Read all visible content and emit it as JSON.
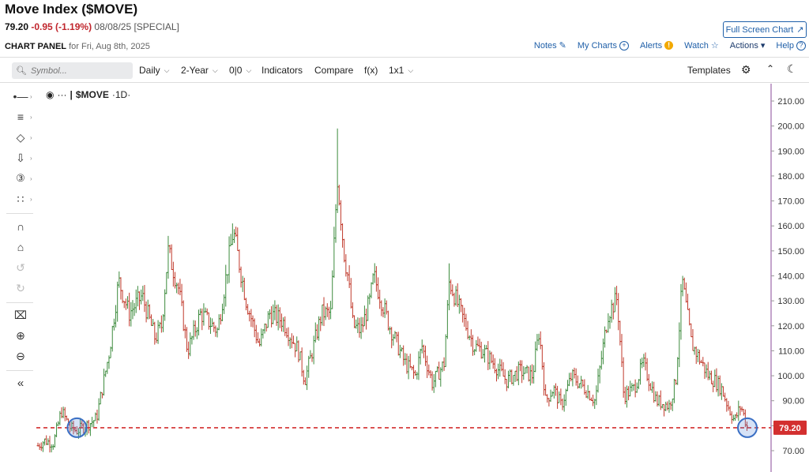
{
  "header": {
    "title": "Move Index ($MOVE)",
    "price": "79.20",
    "change": "-0.95 (-1.19%)",
    "date_meta": "08/08/25 [SPECIAL]",
    "full_screen_label": "Full Screen Chart"
  },
  "panel": {
    "label": "CHART PANEL",
    "for_text": "for Fri, Aug 8th, 2025"
  },
  "links": {
    "notes": "Notes",
    "my_charts": "My Charts",
    "alerts": "Alerts",
    "watch": "Watch",
    "actions": "Actions",
    "help": "Help"
  },
  "toolbar": {
    "search_placeholder": "Symbol...",
    "interval": "Daily",
    "range": "2-Year",
    "chart_style": "0|0",
    "indicators": "Indicators",
    "compare": "Compare",
    "fx": "f(x)",
    "layout": "1x1",
    "templates": "Templates"
  },
  "legend": {
    "symbol": "$MOVE",
    "interval": "1D"
  },
  "icons": {
    "sidebar": [
      "crosshair-icon",
      "fib-tools-icon",
      "shapes-icon",
      "arrow-icon",
      "counter-icon",
      "patterns-icon",
      "magnet-icon",
      "lock-icon",
      "undo-icon",
      "redo-icon",
      "trash-icon",
      "zoom-in-icon",
      "zoom-out-icon",
      "collapse-icon"
    ]
  },
  "chart_data": {
    "type": "ohlc",
    "symbol": "$MOVE",
    "interval": "1D",
    "range": "2-Year",
    "ylim": [
      63,
      215
    ],
    "y_ticks": [
      70,
      80,
      90,
      100,
      110,
      120,
      130,
      140,
      150,
      160,
      170,
      180,
      190,
      200,
      210
    ],
    "y_tick_labels": [
      "70.00",
      "80.00",
      "90.00",
      "100.00",
      "110.00",
      "120.00",
      "130.00",
      "140.00",
      "150.00",
      "160.00",
      "170.00",
      "180.00",
      "190.00",
      "200.00",
      "210.00"
    ],
    "last_price": 79.2,
    "last_price_label": "79.20",
    "x_range_days": [
      0,
      505
    ],
    "key_points": [
      [
        0,
        72
      ],
      [
        5,
        74
      ],
      [
        12,
        73
      ],
      [
        18,
        86
      ],
      [
        25,
        79
      ],
      [
        30,
        78
      ],
      [
        40,
        81
      ],
      [
        45,
        83
      ],
      [
        55,
        110
      ],
      [
        62,
        138
      ],
      [
        70,
        125
      ],
      [
        80,
        132
      ],
      [
        90,
        115
      ],
      [
        95,
        120
      ],
      [
        100,
        150
      ],
      [
        108,
        135
      ],
      [
        115,
        110
      ],
      [
        125,
        125
      ],
      [
        138,
        118
      ],
      [
        150,
        158
      ],
      [
        160,
        130
      ],
      [
        170,
        112
      ],
      [
        178,
        125
      ],
      [
        188,
        122
      ],
      [
        200,
        110
      ],
      [
        205,
        98
      ],
      [
        218,
        125
      ],
      [
        225,
        125
      ],
      [
        230,
        180
      ],
      [
        235,
        150
      ],
      [
        238,
        140
      ],
      [
        242,
        120
      ],
      [
        248,
        118
      ],
      [
        255,
        130
      ],
      [
        258,
        140
      ],
      [
        270,
        120
      ],
      [
        282,
        105
      ],
      [
        290,
        100
      ],
      [
        295,
        112
      ],
      [
        303,
        97
      ],
      [
        312,
        105
      ],
      [
        316,
        138
      ],
      [
        325,
        125
      ],
      [
        335,
        112
      ],
      [
        342,
        110
      ],
      [
        350,
        105
      ],
      [
        360,
        98
      ],
      [
        370,
        102
      ],
      [
        380,
        100
      ],
      [
        385,
        118
      ],
      [
        390,
        90
      ],
      [
        396,
        95
      ],
      [
        402,
        88
      ],
      [
        410,
        100
      ],
      [
        420,
        95
      ],
      [
        428,
        90
      ],
      [
        438,
        125
      ],
      [
        445,
        131
      ],
      [
        450,
        92
      ],
      [
        458,
        95
      ],
      [
        465,
        105
      ],
      [
        475,
        90
      ],
      [
        485,
        88
      ],
      [
        490,
        98
      ],
      [
        495,
        138
      ],
      [
        502,
        113
      ],
      [
        510,
        105
      ],
      [
        515,
        100
      ],
      [
        520,
        98
      ],
      [
        525,
        95
      ],
      [
        530,
        88
      ],
      [
        535,
        82
      ],
      [
        540,
        88
      ],
      [
        545,
        79.2
      ]
    ],
    "annotations": [
      {
        "type": "horizontal_line",
        "value": 79.2,
        "style": "dashed",
        "color": "#d32f2f"
      },
      {
        "type": "circle",
        "x": 30,
        "value": 79.2,
        "color": "#3a6fc4"
      },
      {
        "type": "circle",
        "x": 545,
        "value": 79.2,
        "color": "#3a6fc4"
      }
    ],
    "colors": {
      "up": "#3d8b3d",
      "down": "#c0392b",
      "last_price_box": "#d32f2f",
      "axis_line": "#8a4a9a"
    }
  }
}
